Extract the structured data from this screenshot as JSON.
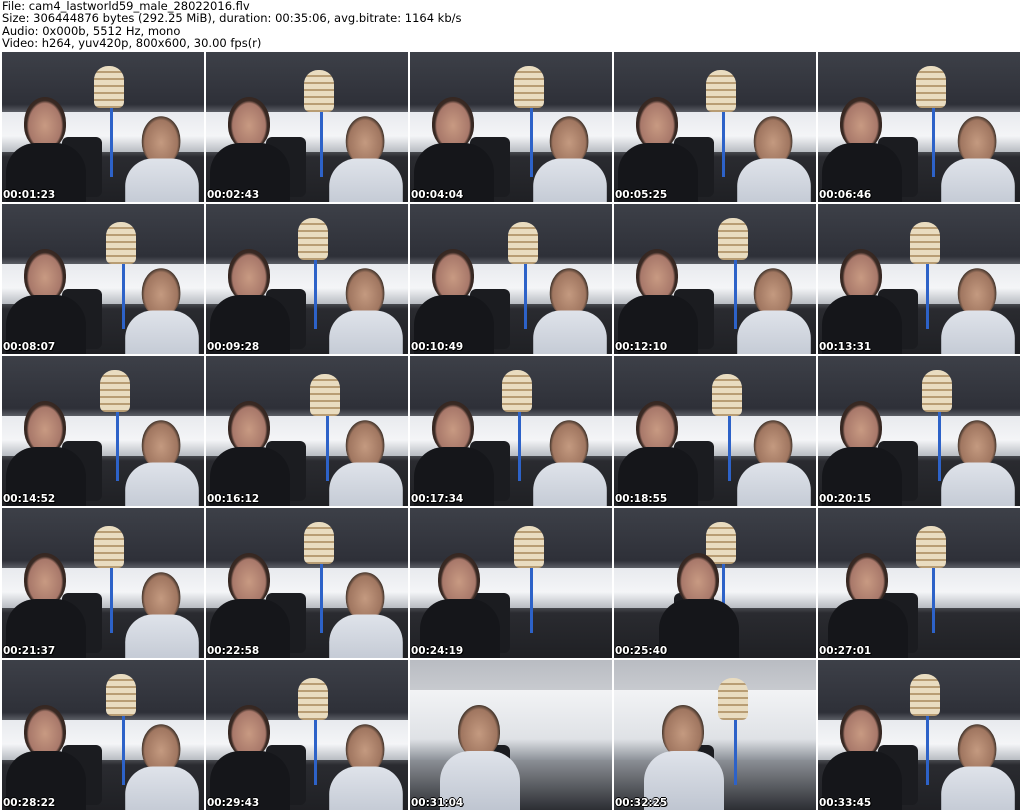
{
  "header": {
    "file_line": "File: cam4_lastworld59_male_28022016.flv",
    "size_line": "Size: 306444876 bytes (292.25 MiB), duration: 00:35:06, avg.bitrate: 1164 kb/s",
    "audio_line": "Audio: 0x000b, 5512 Hz, mono",
    "video_line": "Video: h264, yuv420p, 800x600, 30.00 fps(r)"
  },
  "thumbnails": [
    {
      "timestamp": "00:01:23",
      "people": 2,
      "scene": "car-interior"
    },
    {
      "timestamp": "00:02:43",
      "people": 2,
      "scene": "car-interior"
    },
    {
      "timestamp": "00:04:04",
      "people": 2,
      "scene": "car-interior"
    },
    {
      "timestamp": "00:05:25",
      "people": 2,
      "scene": "car-interior"
    },
    {
      "timestamp": "00:06:46",
      "people": 2,
      "scene": "car-interior"
    },
    {
      "timestamp": "00:08:07",
      "people": 2,
      "scene": "car-interior"
    },
    {
      "timestamp": "00:09:28",
      "people": 2,
      "scene": "car-interior"
    },
    {
      "timestamp": "00:10:49",
      "people": 2,
      "scene": "car-interior"
    },
    {
      "timestamp": "00:12:10",
      "people": 2,
      "scene": "car-interior"
    },
    {
      "timestamp": "00:13:31",
      "people": 2,
      "scene": "car-interior"
    },
    {
      "timestamp": "00:14:52",
      "people": 2,
      "scene": "car-interior"
    },
    {
      "timestamp": "00:16:12",
      "people": 2,
      "scene": "car-interior"
    },
    {
      "timestamp": "00:17:34",
      "people": 2,
      "scene": "car-interior"
    },
    {
      "timestamp": "00:18:55",
      "people": 2,
      "scene": "car-interior"
    },
    {
      "timestamp": "00:20:15",
      "people": 2,
      "scene": "car-interior"
    },
    {
      "timestamp": "00:21:37",
      "people": 2,
      "scene": "car-interior"
    },
    {
      "timestamp": "00:22:58",
      "people": 2,
      "scene": "car-interior"
    },
    {
      "timestamp": "00:24:19",
      "people": 1,
      "scene": "car-interior"
    },
    {
      "timestamp": "00:25:40",
      "people": 1,
      "scene": "car-interior"
    },
    {
      "timestamp": "00:27:01",
      "people": 1,
      "scene": "car-interior"
    },
    {
      "timestamp": "00:28:22",
      "people": 2,
      "scene": "car-interior"
    },
    {
      "timestamp": "00:29:43",
      "people": 2,
      "scene": "car-interior"
    },
    {
      "timestamp": "00:31:04",
      "people": 1,
      "scene": "car-bright"
    },
    {
      "timestamp": "00:32:25",
      "people": 1,
      "scene": "car-bright"
    },
    {
      "timestamp": "00:33:45",
      "people": 2,
      "scene": "car-interior"
    }
  ]
}
